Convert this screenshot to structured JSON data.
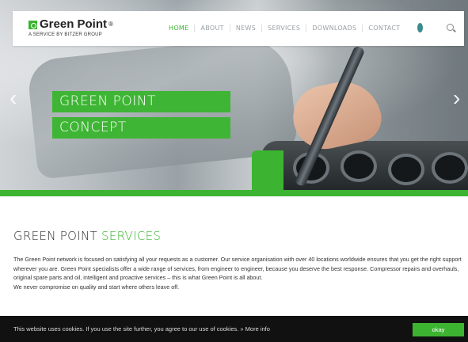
{
  "brand": {
    "name": "Green Point",
    "registered": "®",
    "tagline": "A SERVICE BY BITZER GROUP"
  },
  "nav": {
    "items": [
      {
        "label": "HOME",
        "active": true
      },
      {
        "label": "ABOUT",
        "active": false
      },
      {
        "label": "NEWS",
        "active": false
      },
      {
        "label": "SERVICES",
        "active": false
      },
      {
        "label": "DOWNLOADS",
        "active": false
      },
      {
        "label": "CONTACT",
        "active": false
      }
    ]
  },
  "hero": {
    "banner_line1": "GREEN POINT",
    "banner_line2": "CONCEPT",
    "prev_arrow": "‹",
    "next_arrow": "›"
  },
  "services": {
    "heading_main": "GREEN POINT",
    "heading_highlight": "SERVICES",
    "paragraph1": "The Green Point network is focused on satisfying all your requests as a customer. Our service organisation with over 40 locations worldwide ensures that you get the right support wherever you are. Green Point specialists offer a wide range of services, from engineer to engineer, because you deserve the best response. Compressor repairs and overhauls, original spare parts and oil, intelligent and proactive services – this is what Green Point is all about.",
    "paragraph2": "We never compromise on quality and start where others leave off."
  },
  "cookie": {
    "message": "This website uses cookies. If you use the site further, you agree to our use of cookies.",
    "more_info": "» More info",
    "button": "okay"
  },
  "colors": {
    "accent": "#3cb431",
    "cookie_bg": "#111111"
  },
  "icons": [
    "language-flag-icon",
    "search-icon",
    "prev-slide-icon",
    "next-slide-icon"
  ]
}
